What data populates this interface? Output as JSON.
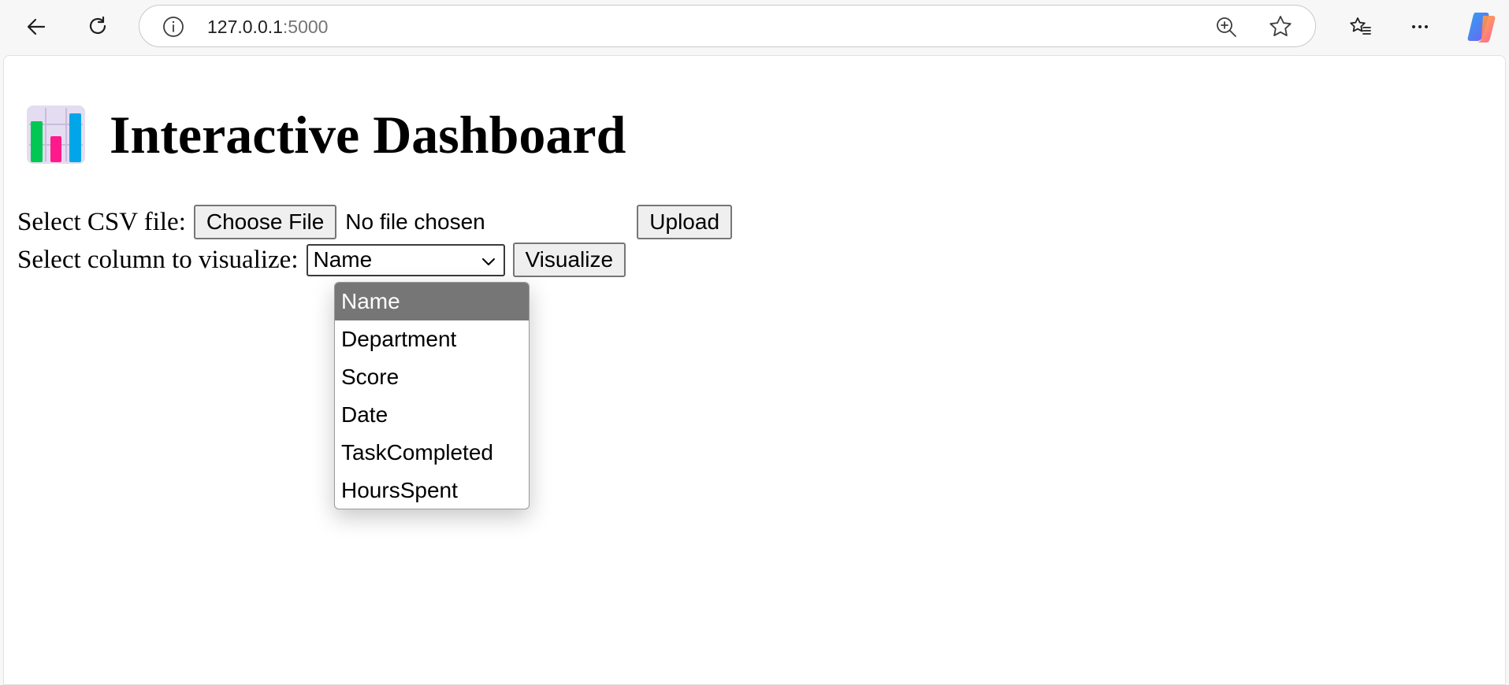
{
  "browser": {
    "url_host": "127.0.0.1",
    "url_port": ":5000",
    "icons": [
      "back-arrow-icon",
      "reload-icon",
      "info-icon",
      "zoom-icon",
      "star-icon",
      "favorites-icon",
      "more-icon",
      "copilot-icon"
    ]
  },
  "page": {
    "title": "Interactive Dashboard",
    "title_icon": "bar-chart-icon",
    "upload_form": {
      "label": "Select CSV file:",
      "choose_button": "Choose File",
      "file_status": "No file chosen",
      "upload_button": "Upload"
    },
    "visualize_form": {
      "label": "Select column to visualize:",
      "selected_value": "Name",
      "visualize_button": "Visualize",
      "options": [
        "Name",
        "Department",
        "Score",
        "Date",
        "TaskCompleted",
        "HoursSpent"
      ]
    }
  },
  "colors": {
    "selected_option_bg": "#767676",
    "button_bg": "#efefef",
    "chart_icon_green": "#00c853",
    "chart_icon_pink": "#ff1a8c",
    "chart_icon_blue": "#00a6e8"
  }
}
